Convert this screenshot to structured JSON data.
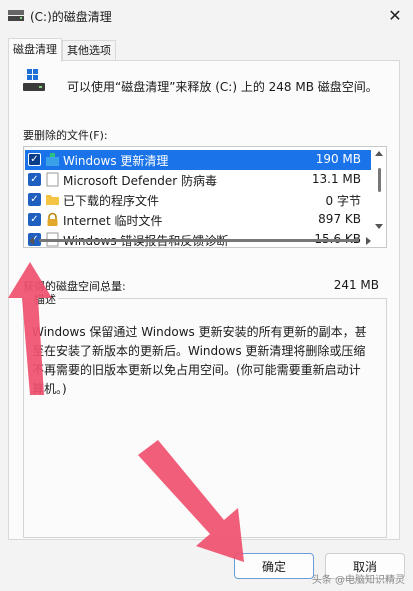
{
  "window": {
    "title": "(C:)的磁盘清理",
    "close_glyph": "✕"
  },
  "tabs": [
    {
      "label": "磁盘清理",
      "active": true
    },
    {
      "label": "其他选项",
      "active": false
    }
  ],
  "summary": "可以使用“磁盘清理”来释放 (C:) 上的 248 MB 磁盘空间。",
  "files_label": "要删除的文件(F):",
  "files": [
    {
      "name": "Windows 更新清理",
      "size": "190 MB",
      "checked": true,
      "selected": true,
      "icon": "windows-update-icon"
    },
    {
      "name": "Microsoft Defender 防病毒",
      "size": "13.1 MB",
      "checked": true,
      "selected": false,
      "icon": "blank-file-icon"
    },
    {
      "name": "已下载的程序文件",
      "size": "0 字节",
      "checked": true,
      "selected": false,
      "icon": "folder-icon"
    },
    {
      "name": "Internet 临时文件",
      "size": "897 KB",
      "checked": true,
      "selected": false,
      "icon": "lock-icon"
    },
    {
      "name": "Windows 错误报告和反馈诊断",
      "size": "15.6 KB",
      "checked": true,
      "selected": false,
      "icon": "blank-file-icon"
    }
  ],
  "total_label": "获得的磁盘空间总量:",
  "total_value": "241 MB",
  "description": {
    "legend": "描述",
    "text": "Windows 保留通过 Windows 更新安装的所有更新的副本，甚至在安装了新版本的更新后。Windows 更新清理将删除或压缩不再需要的旧版本更新以免占用空间。(你可能需要重新启动计算机。)"
  },
  "buttons": {
    "ok": "确定",
    "cancel": "取消"
  },
  "watermark": "头条 @电脑知识精灵",
  "colors": {
    "selection": "#1a73e8",
    "checkbox": "#1f5fbf",
    "arrow": "#f0506e"
  }
}
